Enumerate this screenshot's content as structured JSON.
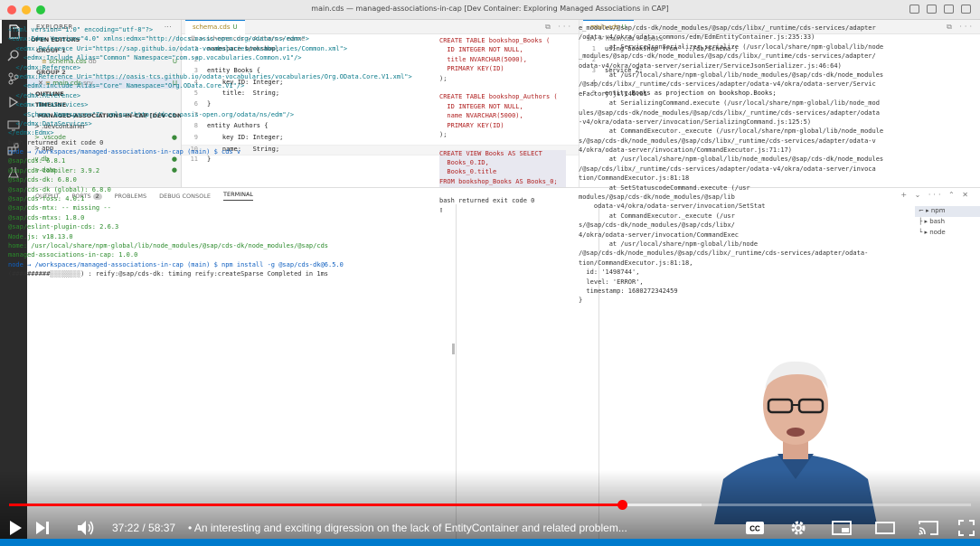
{
  "window": {
    "title": "main.cds — managed-associations-in-cap [Dev Container: Exploring Managed Associations in CAP]"
  },
  "sidebar": {
    "header": "EXPLORER",
    "sections": {
      "open_editors": "OPEN EDITORS",
      "group1": "GROUP 1",
      "group2": "GROUP 2",
      "outline": "OUTLINE",
      "timeline": "TIMELINE",
      "project": "MANAGED-ASSOCIATIONS-IN-CAP [DEV CONTA..."
    },
    "open_files": [
      {
        "name": "schema.cds",
        "folder": "db",
        "status": "U"
      },
      {
        "name": "main.cds",
        "folder": "srv",
        "status": "U"
      }
    ],
    "tree": [
      {
        "label": "> .devcontainer",
        "status": ""
      },
      {
        "label": "> .vscode",
        "status": "●"
      },
      {
        "label": "> app",
        "status": ""
      },
      {
        "label": "∨ db",
        "status": "●"
      },
      {
        "label": "  > data",
        "status": "●"
      }
    ]
  },
  "editor1": {
    "tab": {
      "name": "schema.cds",
      "status": "U"
    },
    "breadcrumb": "db > schema.cds > Authors > name",
    "lines": [
      {
        "n": "1",
        "text": "namespace bookshop;"
      },
      {
        "n": "2",
        "text": ""
      },
      {
        "n": "3",
        "text": "entity Books {"
      },
      {
        "n": "4",
        "text": "    key ID: Integer;"
      },
      {
        "n": "5",
        "text": "    title:  String;"
      },
      {
        "n": "6",
        "text": "}"
      },
      {
        "n": "7",
        "text": ""
      },
      {
        "n": "8",
        "text": "entity Authors {"
      },
      {
        "n": "9",
        "text": "    key ID: Integer;"
      },
      {
        "n": "10",
        "text": "    name:   String;"
      },
      {
        "n": "11",
        "text": "}"
      }
    ]
  },
  "editor2": {
    "tab": {
      "name": "main.cds",
      "status": "U"
    },
    "breadcrumb": "srv > main.cds > Books",
    "lines": [
      {
        "n": "1",
        "text": "using bookshop from '../db/schema';"
      },
      {
        "n": "2",
        "text": ""
      },
      {
        "n": "3",
        "text": "service Z;"
      },
      {
        "n": "4",
        "text": ""
      },
      {
        "n": "5",
        "text": "entity Books as projection on bookshop.Books;"
      }
    ]
  },
  "panel": {
    "tabs": [
      "OUTPUT",
      "PORTS",
      "PROBLEMS",
      "DEBUG CONSOLE",
      "TERMINAL"
    ],
    "ports_badge": "2",
    "terminals": [
      "npm",
      "bash",
      "node"
    ]
  },
  "terminal1": [
    "<?xml version=\"1.0\" encoding=\"utf-8\"?>",
    "<edmx:Edmx Version=\"4.0\" xmlns:edmx=\"http://docs.oasis-open.org/odata/ns/edmx\">",
    "  <edmx:Reference Uri=\"https://sap.github.io/odata-vocabularies/vocabularies/Common.xml\">",
    "    <edmx:Include Alias=\"Common\" Namespace=\"com.sap.vocabularies.Common.v1\"/>",
    "  </edmx:Reference>",
    "  <edmx:Reference Uri=\"https://oasis-tcs.github.io/odata-vocabularies/vocabularies/Org.OData.Core.V1.xml\">",
    "    <edmx:Include Alias=\"Core\" Namespace=\"Org.OData.Core.V1\"/>",
    "  </edmx:Reference>",
    "  <edmx:DataServices>",
    "    <Schema Namespace=\"Z\" xmlns=\"http://docs.oasis-open.org/odata/ns/edm\"/>",
    "  </edmx:DataServices>",
    "</edmx:Edmx>",
    "bash returned exit code 0",
    "node → /workspaces/managed-associations-in-cap (main) $ cds v",
    "@sap/cds: 6.8.1",
    "@sap/cds-compiler: 3.9.2",
    "@sap/cds-dk: 6.8.0",
    "@sap/cds-dk (global): 6.8.0",
    "@sap/cds-foss: 4.0.1",
    "@sap/cds-mtx: -- missing --",
    "@sap/cds-mtxs: 1.8.0",
    "@sap/eslint-plugin-cds: 2.6.3",
    "Node.js: v18.13.0",
    "home: /usr/local/share/npm-global/lib/node_modules/@sap/cds-dk/node_modules/@sap/cds",
    "managed-associations-in-cap: 1.0.0",
    "node → /workspaces/managed-associations-in-cap (main) $ npm install -g @sap/cds-dk@6.5.0",
    "(##########░░░░░░░░) : reify:@sap/cds-dk: timing reify:createSparse Completed in 1ms"
  ],
  "terminal2": [
    "CREATE TABLE bookshop_Books (",
    "  ID INTEGER NOT NULL,",
    "  title NVARCHAR(5000),",
    "  PRIMARY KEY(ID)",
    ");",
    "",
    "CREATE TABLE bookshop_Authors (",
    "  ID INTEGER NOT NULL,",
    "  name NVARCHAR(5000),",
    "  PRIMARY KEY(ID)",
    ");",
    "",
    "CREATE VIEW Books AS SELECT",
    "  Books_0.ID,",
    "  Books_0.title",
    "FROM bookshop_Books AS Books_0;",
    "",
    "bash returned exit code 0",
    "▯"
  ],
  "terminal3": [
    "e_modules/@sap/cds-dk/node_modules/@sap/cds/libx/_runtime/cds-services/adapter",
    "/odata-v4/okra/odata-commons/edm/EdmEntityContainer.js:235:33)",
    "        at ServiceJsonSerializer.serialize (/usr/local/share/npm-global/lib/node",
    "_modules/@sap/cds-dk/node_modules/@sap/cds/libx/_runtime/cds-services/adapter/",
    "odata-v4/okra/odata-server/serializer/ServiceJsonSerializer.js:46:64)",
    "        at /usr/local/share/npm-global/lib/node_modules/@sap/cds-dk/node_modules",
    "/@sap/cds/libx/_runtime/cds-services/adapter/odata-v4/okra/odata-server/Servic",
    "eFactory.js:146:61",
    "        at SerializingCommand.execute (/usr/local/share/npm-global/lib/node_mod",
    "ules/@sap/cds-dk/node_modules/@sap/cds/libx/_runtime/cds-services/adapter/odata",
    "-v4/okra/odata-server/invocation/SerializingCommand.js:125:5)",
    "        at CommandExecutor._execute (/usr/local/share/npm-global/lib/node_module",
    "s/@sap/cds-dk/node_modules/@sap/cds/libx/_runtime/cds-services/adapter/odata-v",
    "4/okra/odata-server/invocation/CommandExecutor.js:71:17)",
    "        at /usr/local/share/npm-global/lib/node_modules/@sap/cds-dk/node_modules",
    "/@sap/cds/libx/_runtime/cds-services/adapter/odata-v4/okra/odata-server/invoca",
    "tion/CommandExecutor.js:81:18",
    "        at SetStatuscodeCommand.execute (/usr",
    "modules/@sap/cds-dk/node_modules/@sap/lib",
    "    odata-v4/okra/odata-server/invocation/SetStat",
    "        at CommandExecutor._execute (/usr",
    "s/@sap/cds-dk/node_modules/@sap/cds/libx/",
    "4/okra/odata-server/invocation/CommandExec",
    "        at /usr/local/share/npm-global/lib/node",
    "/@sap/cds-dk/node_modules/@sap/cds/libx/_runtime/cds-services/adapter/odata-",
    "tion/CommandExecutor.js:81:18,",
    "  id: '1498744',",
    "  level: 'ERROR',",
    "  timestamp: 1680272342459",
    "}"
  ],
  "video": {
    "current_time": "37:22",
    "duration": "58:37",
    "time_separator": " / ",
    "chapter_title": "• An interesting and exciting digression on the lack of EntityContainer and related problem...",
    "progress_played": 0.637,
    "progress_buffered": 0.72,
    "cc_label": "CC"
  }
}
